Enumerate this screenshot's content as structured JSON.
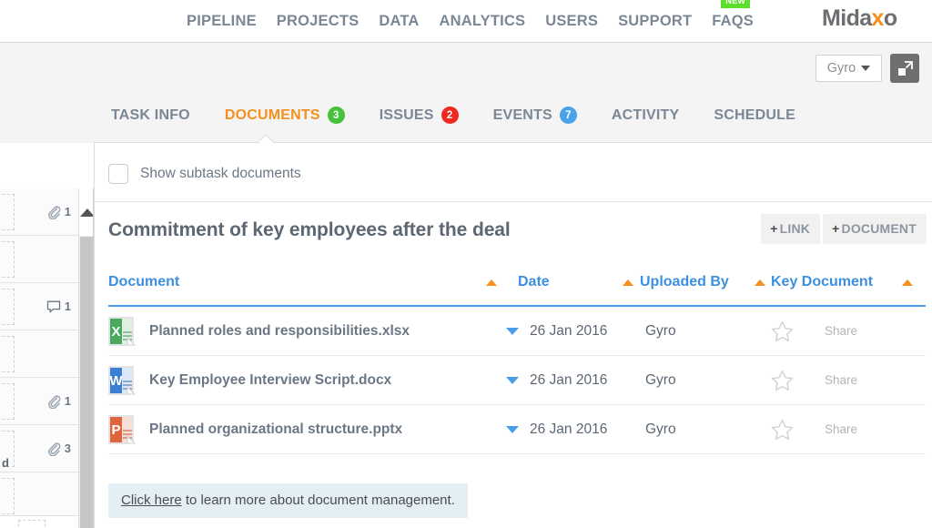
{
  "topnav": {
    "links": [
      {
        "label": "PIPELINE",
        "name": "nav-pipeline"
      },
      {
        "label": "PROJECTS",
        "name": "nav-projects"
      },
      {
        "label": "DATA",
        "name": "nav-data"
      },
      {
        "label": "ANALYTICS",
        "name": "nav-analytics"
      },
      {
        "label": "USERS",
        "name": "nav-users"
      },
      {
        "label": "SUPPORT",
        "name": "nav-support"
      },
      {
        "label": "FAQS",
        "name": "nav-faqs",
        "badge": "NEW"
      }
    ],
    "badge_new": "NEW",
    "brand_part1": "Mida",
    "brand_x": "x",
    "brand_part2": "o",
    "brand_color": "#6d6e71",
    "brand_accent": "#f5901e"
  },
  "controls": {
    "account_label": "Gyro",
    "expand_icon": "expand-icon"
  },
  "tabs": [
    {
      "label": "TASK INFO",
      "name": "tab-task-info",
      "active": false,
      "badge": null
    },
    {
      "label": "DOCUMENTS",
      "name": "tab-documents",
      "active": true,
      "badge": "3",
      "badge_color": "#46c13a"
    },
    {
      "label": "ISSUES",
      "name": "tab-issues",
      "active": false,
      "badge": "2",
      "badge_color": "#ef2a21"
    },
    {
      "label": "EVENTS",
      "name": "tab-events",
      "active": false,
      "badge": "7",
      "badge_color": "#4aa3e8"
    },
    {
      "label": "ACTIVITY",
      "name": "tab-activity",
      "active": false,
      "badge": null
    },
    {
      "label": "SCHEDULE",
      "name": "tab-schedule",
      "active": false,
      "badge": null
    }
  ],
  "panel": {
    "show_subtask_label": "Show subtask documents",
    "show_subtask_checked": false,
    "title": "Commitment of key employees after the deal",
    "buttons": [
      {
        "plus": "+",
        "label": "LINK",
        "name": "add-link-button"
      },
      {
        "plus": "+",
        "label": "DOCUMENT",
        "name": "add-document-button"
      }
    ]
  },
  "table": {
    "headers": [
      {
        "label": "Document",
        "name": "column-header-document"
      },
      {
        "label": "Date",
        "name": "column-header-date"
      },
      {
        "label": "Uploaded By",
        "name": "column-header-uploaded-by"
      },
      {
        "label": "Key Document",
        "name": "column-header-key-document"
      }
    ],
    "sort_color": "#f5901e",
    "header_color": "#3d8fe0",
    "rows": [
      {
        "icon": "excel-file-icon",
        "name": "Planned roles and responsibilities.xlsx",
        "date": "26 Jan 2016",
        "uploaded_by": "Gyro",
        "key_document": false,
        "share_label": "Share"
      },
      {
        "icon": "word-file-icon",
        "name": "Key Employee Interview Script.docx",
        "date": "26 Jan 2016",
        "uploaded_by": "Gyro",
        "key_document": false,
        "share_label": "Share"
      },
      {
        "icon": "powerpoint-file-icon",
        "name": "Planned organizational structure.pptx",
        "date": "26 Jan 2016",
        "uploaded_by": "Gyro",
        "key_document": false,
        "share_label": "Share"
      }
    ]
  },
  "info_banner": {
    "link_text": "Click here",
    "rest_text": " to learn more about document management."
  },
  "sidebar": {
    "rows": [
      {
        "icon": "paperclip-icon",
        "count": "1"
      },
      {
        "icon": null,
        "count": null
      },
      {
        "icon": "comment-icon",
        "count": "1"
      },
      {
        "icon": null,
        "count": null
      },
      {
        "icon": "paperclip-icon",
        "count": "1"
      },
      {
        "icon": "paperclip-icon",
        "count": "3",
        "fragment": "d"
      },
      {
        "icon": null,
        "count": null
      }
    ]
  }
}
